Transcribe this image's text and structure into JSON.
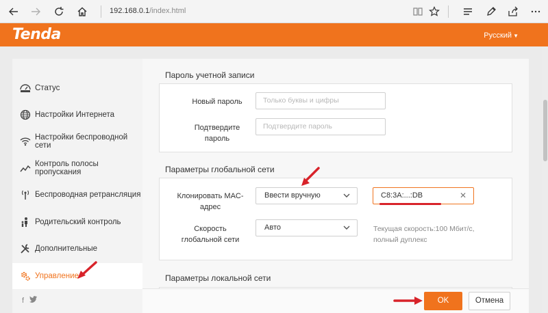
{
  "browser": {
    "url_host": "192.168.0.1",
    "url_path": "/index.html"
  },
  "header": {
    "logo": "Tenda",
    "language": "Русский"
  },
  "sidebar": {
    "items": [
      {
        "label": "Статус",
        "icon": "status-icon"
      },
      {
        "label": "Настройки Интернета",
        "icon": "globe-icon"
      },
      {
        "label": "Настройки беспроводной сети",
        "icon": "wifi-icon"
      },
      {
        "label": "Контроль полосы пропускания",
        "icon": "bandwidth-icon"
      },
      {
        "label": "Беспроводная ретрансляция",
        "icon": "antenna-icon"
      },
      {
        "label": "Родительский контроль",
        "icon": "parent-icon"
      },
      {
        "label": "Дополнительные",
        "icon": "tools-icon"
      },
      {
        "label": "Управление",
        "icon": "gears-icon",
        "active": true
      }
    ],
    "social": [
      "f",
      "twitter-icon"
    ]
  },
  "account_password": {
    "title": "Пароль учетной записи",
    "new_password_label": "Новый пароль",
    "new_password_placeholder": "Только буквы и цифры",
    "confirm_label_line1": "Подтвердите",
    "confirm_label_line2": "пароль",
    "confirm_placeholder": "Подтвердите пароль"
  },
  "wan": {
    "title": "Параметры глобальной сети",
    "clone_mac_label_line1": "Клонировать MAC-",
    "clone_mac_label_line2": "адрес",
    "clone_mac_mode": "Ввести вручную",
    "mac_value": "C8:3A:...:DB",
    "speed_label_line1": "Скорость",
    "speed_label_line2": "глобальной сети",
    "speed_value": "Авто",
    "speed_hint_line1": "Текущая скорость:100 Мбит/с,",
    "speed_hint_line2": "полный дуплекс"
  },
  "lan": {
    "title": "Параметры локальной сети"
  },
  "footer": {
    "ok_label": "OK",
    "cancel_label": "Отмена"
  },
  "colors": {
    "accent": "#f0731d",
    "annotation": "#d8232a"
  }
}
